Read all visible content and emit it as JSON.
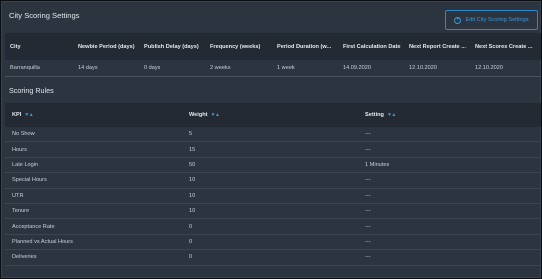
{
  "header": {
    "title": "City Scoring Settings",
    "edit_button": "Edit City Scoring Settings"
  },
  "city_table": {
    "columns": [
      "City",
      "Newbie Period (days)",
      "Publish Delay (days)",
      "Frequency (weeks)",
      "Period Duration (w...",
      "First Calculation Date",
      "Next Report Create ...",
      "Next Scores Create ..."
    ],
    "row": [
      "Barranquilla",
      "14 days",
      "0 days",
      "2 weeks",
      "1 week",
      "14.09.2020",
      "12.10.2020",
      "12.10.2020"
    ]
  },
  "rules": {
    "title": "Scoring Rules",
    "columns": [
      "KPI",
      "Weight",
      "Setting"
    ],
    "sort_icon": "sort-arrows-icon",
    "rows": [
      {
        "kpi": "No Show",
        "weight": "5",
        "setting": "---"
      },
      {
        "kpi": "Hours",
        "weight": "15",
        "setting": "---"
      },
      {
        "kpi": "Late Login",
        "weight": "50",
        "setting": "1 Minutes"
      },
      {
        "kpi": "Special Hours",
        "weight": "10",
        "setting": "---"
      },
      {
        "kpi": "UTR",
        "weight": "10",
        "setting": "---"
      },
      {
        "kpi": "Tenure",
        "weight": "10",
        "setting": "---"
      },
      {
        "kpi": "Acceptance Rate",
        "weight": "0",
        "setting": "---"
      },
      {
        "kpi": "Planned vs Actual Hours",
        "weight": "0",
        "setting": "---"
      },
      {
        "kpi": "Deliveries",
        "weight": "0",
        "setting": "---"
      }
    ]
  },
  "colors": {
    "panel": "#2c3440",
    "header_row": "#232a33",
    "accent": "#3b98d8"
  }
}
